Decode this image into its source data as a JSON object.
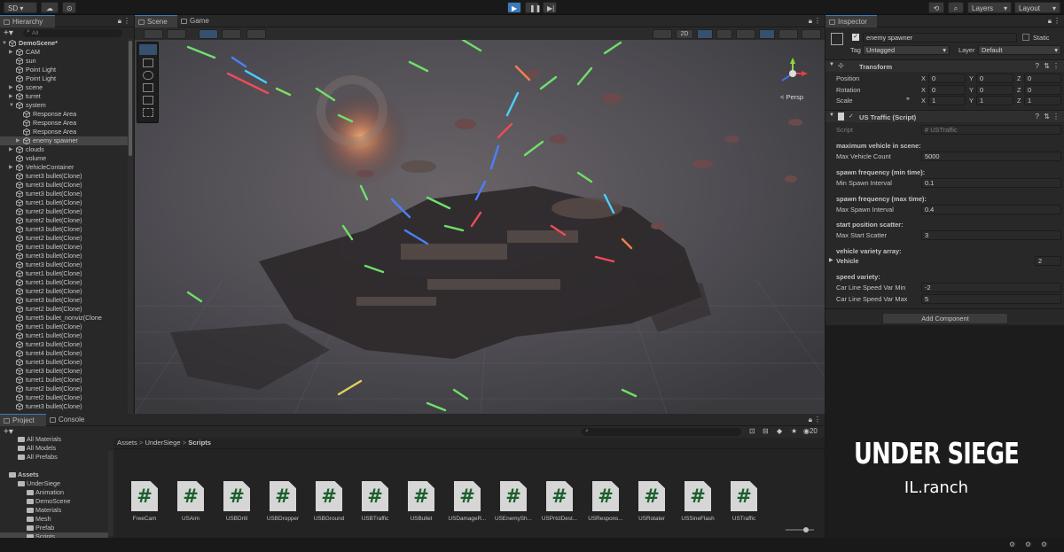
{
  "topbar": {
    "account": "SD",
    "layers": "Layers",
    "layout": "Layout"
  },
  "hierarchy": {
    "tab": "Hierarchy",
    "search_placeholder": "All",
    "items": [
      {
        "label": "DemoScene*",
        "indent": 0,
        "arrow": "▼"
      },
      {
        "label": "CAM",
        "indent": 1,
        "arrow": "▶"
      },
      {
        "label": "sun",
        "indent": 1,
        "arrow": ""
      },
      {
        "label": "Point Light",
        "indent": 1,
        "arrow": ""
      },
      {
        "label": "Point Light",
        "indent": 1,
        "arrow": ""
      },
      {
        "label": "scene",
        "indent": 1,
        "arrow": "▶"
      },
      {
        "label": "turret",
        "indent": 1,
        "arrow": "▶"
      },
      {
        "label": "system",
        "indent": 1,
        "arrow": "▼"
      },
      {
        "label": "Response Area",
        "indent": 2,
        "arrow": ""
      },
      {
        "label": "Response Area",
        "indent": 2,
        "arrow": ""
      },
      {
        "label": "Response Area",
        "indent": 2,
        "arrow": ""
      },
      {
        "label": "enemy spawner",
        "indent": 2,
        "arrow": "▶"
      },
      {
        "label": "clouds",
        "indent": 1,
        "arrow": "▶"
      },
      {
        "label": "volume",
        "indent": 1,
        "arrow": ""
      },
      {
        "label": "VehicleContainer",
        "indent": 1,
        "arrow": "▶"
      },
      {
        "label": "turret3 bullet(Clone)",
        "indent": 1,
        "arrow": ""
      },
      {
        "label": "turret3 bullet(Clone)",
        "indent": 1,
        "arrow": ""
      },
      {
        "label": "turret3 bullet(Clone)",
        "indent": 1,
        "arrow": ""
      },
      {
        "label": "turret1 bullet(Clone)",
        "indent": 1,
        "arrow": ""
      },
      {
        "label": "turret2 bullet(Clone)",
        "indent": 1,
        "arrow": ""
      },
      {
        "label": "turret2 bullet(Clone)",
        "indent": 1,
        "arrow": ""
      },
      {
        "label": "turret3 bullet(Clone)",
        "indent": 1,
        "arrow": ""
      },
      {
        "label": "turret2 bullet(Clone)",
        "indent": 1,
        "arrow": ""
      },
      {
        "label": "turret3 bullet(Clone)",
        "indent": 1,
        "arrow": ""
      },
      {
        "label": "turret3 bullet(Clone)",
        "indent": 1,
        "arrow": ""
      },
      {
        "label": "turret3 bullet(Clone)",
        "indent": 1,
        "arrow": ""
      },
      {
        "label": "turret1 bullet(Clone)",
        "indent": 1,
        "arrow": ""
      },
      {
        "label": "turret1 bullet(Clone)",
        "indent": 1,
        "arrow": ""
      },
      {
        "label": "turret2 bullet(Clone)",
        "indent": 1,
        "arrow": ""
      },
      {
        "label": "turret3 bullet(Clone)",
        "indent": 1,
        "arrow": ""
      },
      {
        "label": "turret2 bullet(Clone)",
        "indent": 1,
        "arrow": ""
      },
      {
        "label": "turret5 bullet_nonviz(Clone",
        "indent": 1,
        "arrow": ""
      },
      {
        "label": "turret1 bullet(Clone)",
        "indent": 1,
        "arrow": ""
      },
      {
        "label": "turret1 bullet(Clone)",
        "indent": 1,
        "arrow": ""
      },
      {
        "label": "turret3 bullet(Clone)",
        "indent": 1,
        "arrow": ""
      },
      {
        "label": "turret4 bullet(Clone)",
        "indent": 1,
        "arrow": ""
      },
      {
        "label": "turret3 bullet(Clone)",
        "indent": 1,
        "arrow": ""
      },
      {
        "label": "turret3 bullet(Clone)",
        "indent": 1,
        "arrow": ""
      },
      {
        "label": "turret1 bullet(Clone)",
        "indent": 1,
        "arrow": ""
      },
      {
        "label": "turret2 bullet(Clone)",
        "indent": 1,
        "arrow": ""
      },
      {
        "label": "turret2 bullet(Clone)",
        "indent": 1,
        "arrow": ""
      },
      {
        "label": "turret3 bullet(Clone)",
        "indent": 1,
        "arrow": ""
      }
    ]
  },
  "scene": {
    "tab_scene": "Scene",
    "tab_game": "Game",
    "btn_2d": "2D",
    "persp": "Persp"
  },
  "inspector": {
    "tab": "Inspector",
    "object_name": "enemy spawner",
    "static_label": "Static",
    "tag_label": "Tag",
    "tag_value": "Untagged",
    "layer_label": "Layer",
    "layer_value": "Default",
    "transform": {
      "title": "Transform",
      "position": {
        "label": "Position",
        "x": "0",
        "y": "0",
        "z": "0"
      },
      "rotation": {
        "label": "Rotation",
        "x": "0",
        "y": "0",
        "z": "0"
      },
      "scale": {
        "label": "Scale",
        "x": "1",
        "y": "1",
        "z": "1"
      }
    },
    "script_comp": {
      "title": "US Traffic (Script)",
      "script_label": "Script",
      "script_value": "USTraffic",
      "h_max": "maximum vehicle in scene:",
      "max_count_label": "Max Vehicle Count",
      "max_count": "5000",
      "h_min_freq": "spawn frequency (min time):",
      "min_interval_label": "Min Spawn Interval",
      "min_interval": "0.1",
      "h_max_freq": "spawn frequency (max time):",
      "max_interval_label": "Max Spawn Interval",
      "max_interval": "0.4",
      "h_scatter": "start position scatter:",
      "scatter_label": "Max Start Scatter",
      "scatter": "3",
      "h_variety": "vehicle variety array:",
      "vehicle_label": "Vehicle",
      "vehicle_count": "2",
      "h_speed": "speed variety:",
      "speed_min_label": "Car Line Speed Var Min",
      "speed_min": "-2",
      "speed_max_label": "Car Line Speed Var Max",
      "speed_max": "5"
    },
    "add_component": "Add Component"
  },
  "project": {
    "tab_project": "Project",
    "tab_console": "Console",
    "tree": [
      {
        "label": "All Materials",
        "indent": 1
      },
      {
        "label": "All Models",
        "indent": 1
      },
      {
        "label": "All Prefabs",
        "indent": 1
      },
      {
        "label": "",
        "indent": 0
      },
      {
        "label": "Assets",
        "indent": 0,
        "bold": true
      },
      {
        "label": "UnderSiege",
        "indent": 1
      },
      {
        "label": "Animation",
        "indent": 2
      },
      {
        "label": "DemoScene",
        "indent": 2
      },
      {
        "label": "Materials",
        "indent": 2
      },
      {
        "label": "Mesh",
        "indent": 2
      },
      {
        "label": "Prefab",
        "indent": 2
      },
      {
        "label": "Scripts",
        "indent": 2,
        "sel": true
      }
    ],
    "breadcrumb": [
      "Assets",
      "UnderSiege",
      "Scripts"
    ],
    "hidden_count": "20",
    "files": [
      "FreeCam",
      "USAim",
      "USBDrill",
      "USBDropper",
      "USBGround",
      "USBTraffic",
      "USBullet",
      "USDamageR...",
      "USEnemySh...",
      "USPrtclDest...",
      "USRespons...",
      "USRotater",
      "USSineFlash",
      "USTraffic"
    ]
  },
  "brand": {
    "title": "UNDER SIEGE",
    "subtitle": "IL.ranch"
  }
}
